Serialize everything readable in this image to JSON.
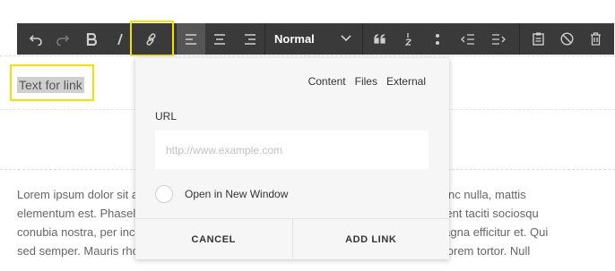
{
  "toolbar": {
    "style_select": {
      "value": "Normal"
    }
  },
  "editor": {
    "selected_text": "Text for link",
    "body_lines": [
      "Lorem ipsum dolor sit amet, consectetur adipiscing elit. Nulla mattis eu. Vivamus nunc nulla, mattis",
      "elementum est. Phasellus ullamcorper tortor porta. Integer at ipsum quet. Class aptent taciti sociosqu",
      "conubia nostra, per inceptos himenaeos. Nam accumsan, nibh eu viverra rutrum magna efficitur et. Qui",
      "sed semper. Mauris rhoncus finibus nisl, in maximus ipsum faucibus ut. Aliquam at lorem tortor. Null"
    ]
  },
  "link_dialog": {
    "tabs": [
      "Content",
      "Files",
      "External"
    ],
    "url_label": "URL",
    "url_placeholder": "http://www.example.com",
    "open_new_window_label": "Open in New Window",
    "cancel_label": "CANCEL",
    "add_label": "ADD LINK"
  }
}
